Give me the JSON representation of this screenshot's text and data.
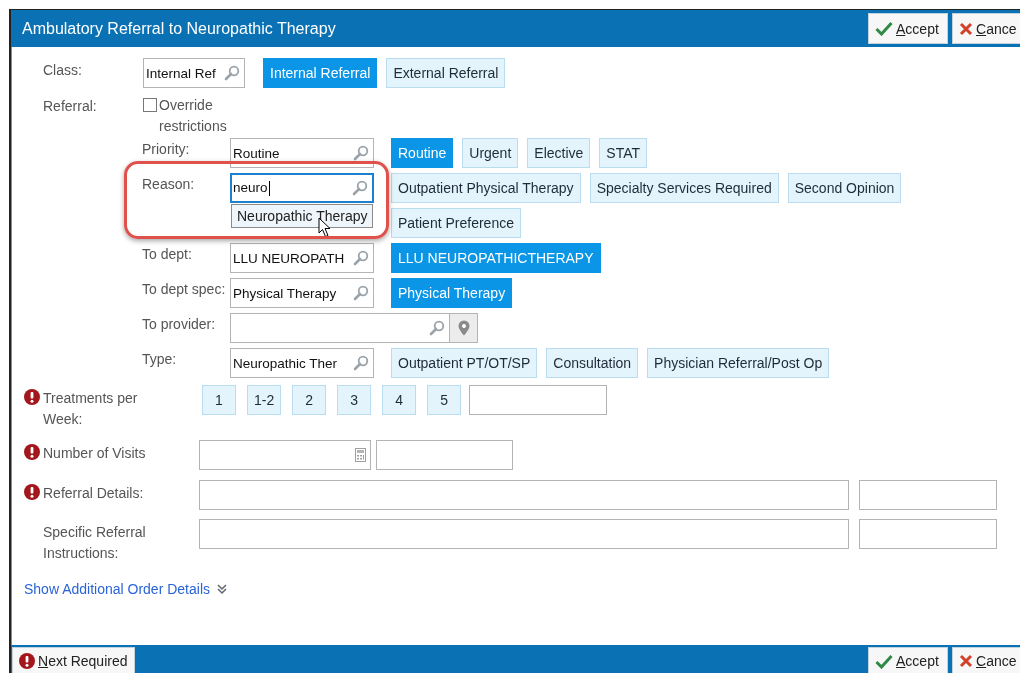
{
  "window": {
    "title": "Ambulatory Referral to Neuropathic Therapy"
  },
  "header_buttons": [
    {
      "kind": "accept",
      "label": "Accept"
    },
    {
      "kind": "cancel",
      "label": "Cance"
    }
  ],
  "class_field": {
    "label": "Class:",
    "value": "Internal Ref",
    "options": [
      {
        "label": "Internal Referral",
        "selected": true
      },
      {
        "label": "External Referral",
        "selected": false
      }
    ]
  },
  "referral": {
    "label": "Referral:",
    "override": {
      "label": "Override restrictions",
      "checked": false
    },
    "fields": [
      {
        "kind": "lookup",
        "label": "Priority:",
        "value": "Routine",
        "focused": false,
        "highlighted": false,
        "options": [
          {
            "label": "Routine",
            "selected": true
          },
          {
            "label": "Urgent",
            "selected": false
          },
          {
            "label": "Elective",
            "selected": false
          },
          {
            "label": "STAT",
            "selected": false
          }
        ]
      },
      {
        "kind": "lookup",
        "label": "Reason:",
        "value": "neuro",
        "focused": true,
        "highlighted": true,
        "suggestions": [
          "Neuropathic Therapy"
        ],
        "options": [
          {
            "label": "Outpatient Physical Therapy",
            "selected": false
          },
          {
            "label": "Specialty Services Required",
            "selected": false
          },
          {
            "label": "Second Opinion",
            "selected": false
          },
          {
            "label": "Patient Preference",
            "selected": false
          }
        ]
      },
      {
        "kind": "lookup",
        "label": "To dept:",
        "value": "LLU NEUROPATH",
        "focused": false,
        "highlighted": false,
        "options": [
          {
            "label": "LLU NEUROPATHICTHERAPY",
            "selected": true
          }
        ]
      },
      {
        "kind": "lookup",
        "label": "To dept spec:",
        "value": "Physical Therapy",
        "focused": false,
        "highlighted": false,
        "options": [
          {
            "label": "Physical Therapy",
            "selected": true
          }
        ]
      },
      {
        "kind": "provider",
        "label": "To provider:",
        "focused": false,
        "highlighted": false
      },
      {
        "kind": "lookup",
        "label": "Type:",
        "value": "Neuropathic Ther",
        "focused": false,
        "highlighted": false,
        "options": [
          {
            "label": "Outpatient PT/OT/SP",
            "selected": false
          },
          {
            "label": "Consultation",
            "selected": false
          },
          {
            "label": "Physician Referral/Post Op",
            "selected": false
          }
        ]
      }
    ]
  },
  "fields": [
    {
      "kind": "choices",
      "label": "Treatments per Week:",
      "required": true,
      "options": [
        {
          "label": "1",
          "selected": false
        },
        {
          "label": "1-2",
          "selected": false
        },
        {
          "label": "2",
          "selected": false
        },
        {
          "label": "3",
          "selected": false
        },
        {
          "label": "4",
          "selected": false
        },
        {
          "label": "5",
          "selected": false
        }
      ]
    },
    {
      "kind": "numeric",
      "label": "Number of Visits",
      "required": true
    },
    {
      "kind": "text",
      "label": "Referral Details:",
      "required": true
    },
    {
      "kind": "text",
      "label": "Specific Referral Instructions:",
      "required": false
    }
  ],
  "more_link": {
    "label": "Show Additional Order Details",
    "expanded": false
  },
  "footer": {
    "next_required": "Next Required",
    "buttons": [
      {
        "kind": "accept",
        "label": "Accept"
      },
      {
        "kind": "cancel",
        "label": "Cance"
      }
    ]
  }
}
